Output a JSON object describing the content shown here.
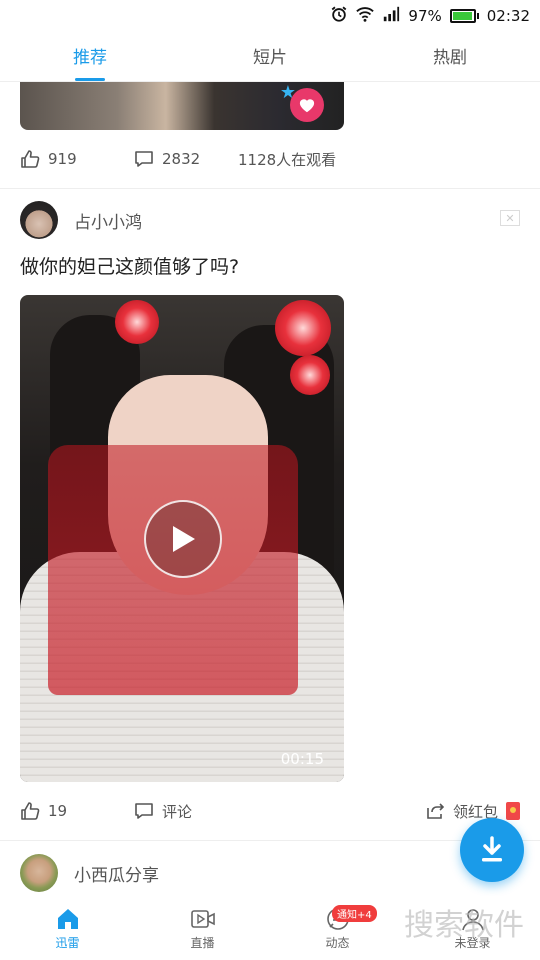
{
  "status_bar": {
    "battery_percent": "97%",
    "time": "02:32",
    "battery_level": 0.97
  },
  "top_tabs": [
    {
      "label": "推荐",
      "active": true
    },
    {
      "label": "短片",
      "active": false
    },
    {
      "label": "热剧",
      "active": false
    }
  ],
  "prev_post": {
    "likes": "919",
    "comments": "2832",
    "viewers": "1128人在观看"
  },
  "post": {
    "author": "占小小鸿",
    "text": "做你的妲己这颜值够了吗?",
    "duration": "00:15",
    "likes": "19",
    "comment_label": "评论",
    "redpack_label": "领红包"
  },
  "next_post": {
    "author": "小西瓜分享"
  },
  "bottom_nav": [
    {
      "label": "迅雷",
      "active": true,
      "icon": "home-icon"
    },
    {
      "label": "直播",
      "active": false,
      "icon": "live-video-icon"
    },
    {
      "label": "动态",
      "active": false,
      "icon": "chat-bubble-icon",
      "badge": "通知+4"
    },
    {
      "label": "未登录",
      "active": false,
      "icon": "user-icon"
    }
  ],
  "watermark": "搜索软件",
  "colors": {
    "accent": "#1a9be9",
    "badge": "#f03d3d",
    "heart": "#e8386a"
  }
}
